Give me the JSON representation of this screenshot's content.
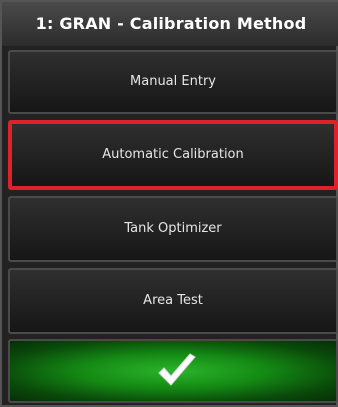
{
  "header": {
    "title": "1: GRAN - Calibration Method"
  },
  "options": [
    {
      "label": "Manual Entry",
      "selected": false
    },
    {
      "label": "Automatic Calibration",
      "selected": true
    },
    {
      "label": "Tank Optimizer",
      "selected": false
    },
    {
      "label": "Area Test",
      "selected": false
    }
  ],
  "confirm": {
    "icon": "checkmark-icon",
    "color": "#2bb52b"
  },
  "colors": {
    "selected_border": "#e0202a"
  }
}
